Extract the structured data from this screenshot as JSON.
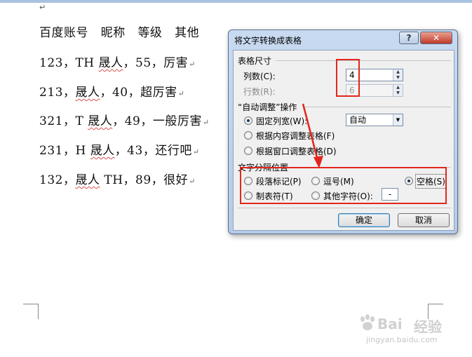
{
  "document": {
    "first_mark": "↵",
    "lines": [
      [
        "百度账号",
        "昵称",
        "等级",
        "其他"
      ],
      [
        "123，TH ",
        "晟人",
        "，55，厉害"
      ],
      [
        "213，",
        "晟人",
        "，40，超厉害"
      ],
      [
        "321，T ",
        "晟人",
        "，49，一般厉害"
      ],
      [
        "231，H ",
        "晟人",
        "，43，还行吧"
      ],
      [
        "132，",
        "晟人",
        " TH，89，很好"
      ]
    ],
    "para_mark": "↵"
  },
  "dialog": {
    "title": "将文字转换成表格",
    "help_label": "?",
    "close_label": "✕",
    "table_size_header": "表格尺寸",
    "columns_label": "列数(C):",
    "columns_value": "4",
    "rows_label": "行数(R):",
    "rows_value": "6",
    "autofit_header": "“自动调整”操作",
    "fixed_width_label": "固定列宽(W):",
    "fixed_width_value": "自动",
    "autofit_content_label": "根据内容调整表格(F)",
    "autofit_window_label": "根据窗口调整表格(D)",
    "separator_header": "文字分隔位置",
    "paragraph_label": "段落标记(P)",
    "comma_label": "逗号(M)",
    "space_label": "空格(S)",
    "tab_label": "制表符(T)",
    "other_label": "其他字符(O):",
    "other_value": "-",
    "ok_label": "确定",
    "cancel_label": "取消",
    "selected_autofit": "fixed_width",
    "selected_separator": "space"
  },
  "watermark": {
    "brand": "Bai",
    "brand_cn": "经验",
    "url": "jingyan.baidu.com"
  },
  "colors": {
    "highlight": "#e3261d",
    "dialog_frame": "#b6cbe6"
  }
}
